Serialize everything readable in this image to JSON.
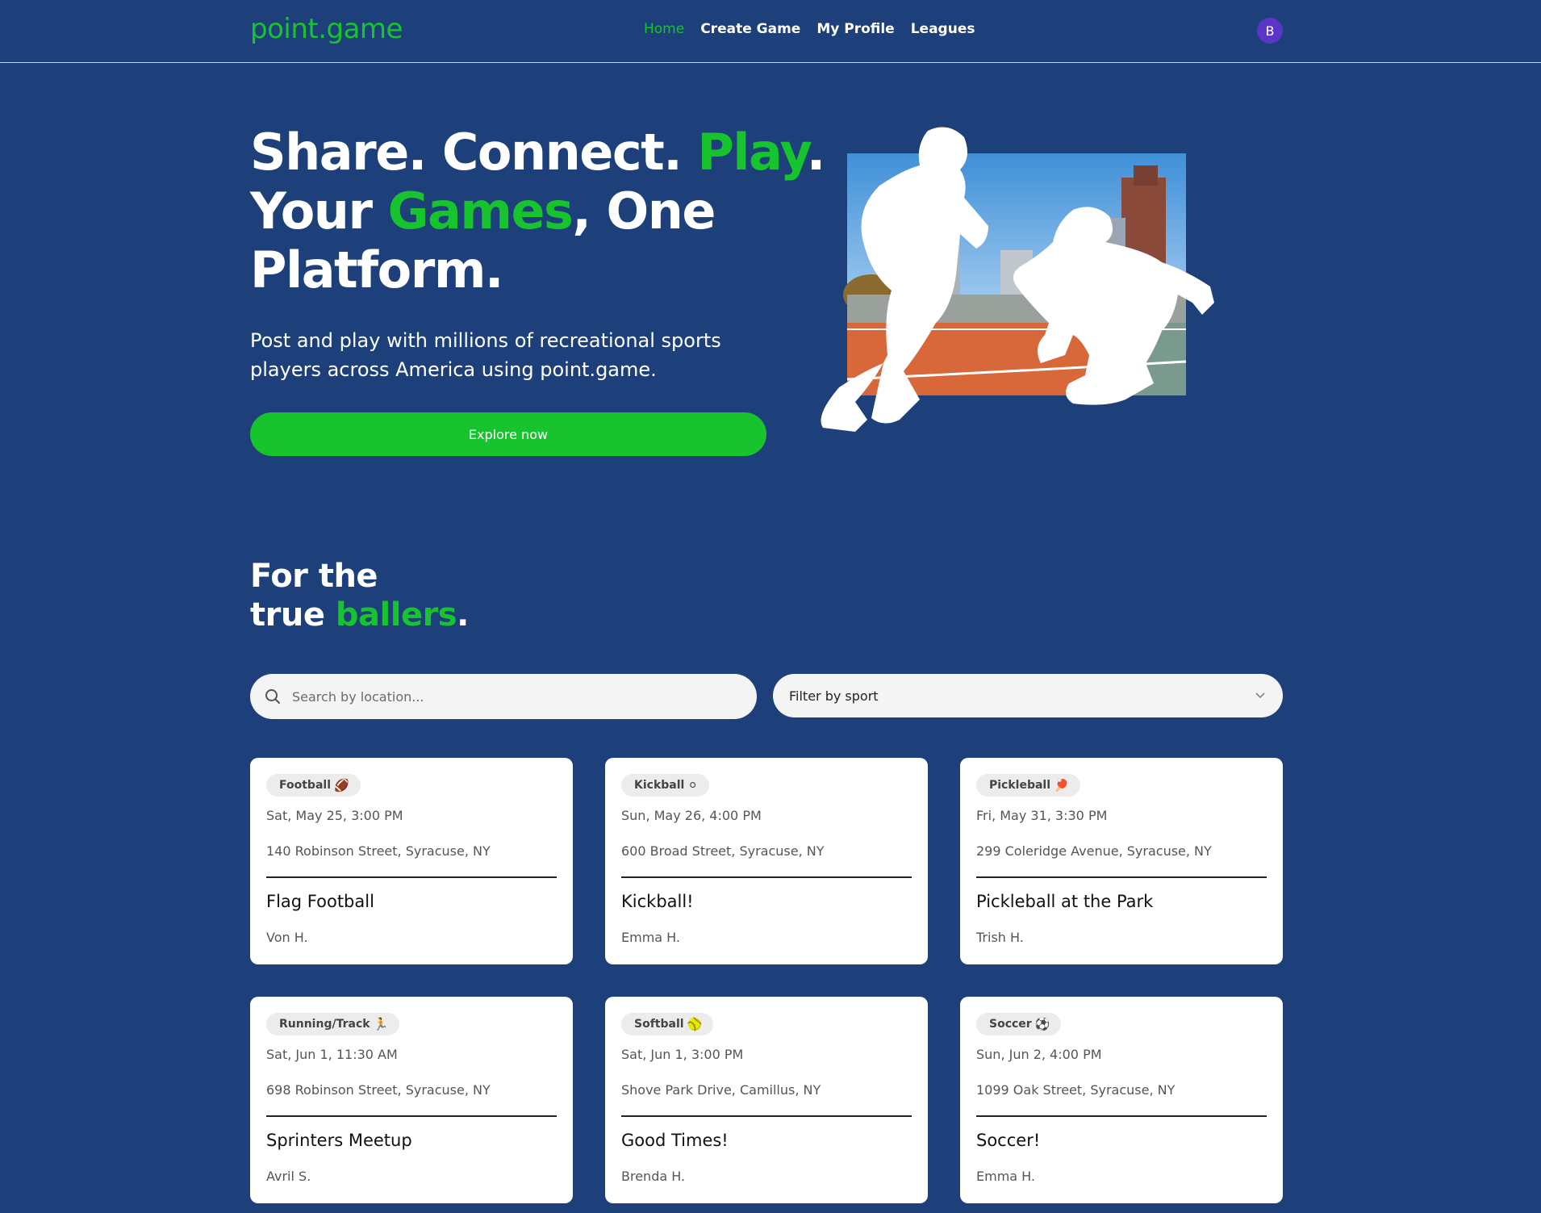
{
  "nav": {
    "brand": "point.game",
    "links": [
      "Home",
      "Create Game",
      "My Profile",
      "Leagues"
    ],
    "avatar_initial": "B"
  },
  "hero": {
    "line1_a": "Share. Connect. ",
    "line1_b": "Play",
    "line1_c": ".",
    "line2_a": "Your ",
    "line2_b": "Games",
    "line2_c": ", One",
    "line3": "Platform.",
    "subtitle": "Post and play with millions of recreational sports players across America using point.game.",
    "cta": "Explore now"
  },
  "section": {
    "line1": "For the",
    "line2_a": "true ",
    "line2_b": "ballers",
    "line2_c": "."
  },
  "search": {
    "placeholder": "Search by location..."
  },
  "filter": {
    "label": "Filter by sport"
  },
  "colors": {
    "accent": "#17c42e",
    "background": "#1d3f7a",
    "avatar": "#5b35c6"
  },
  "games": [
    {
      "sport": "Football",
      "emoji": "🏈",
      "date": "Sat, May 25, 3:00 PM",
      "address": "140 Robinson Street, Syracuse, NY",
      "title": "Flag Football",
      "host": "Von H."
    },
    {
      "sport": "Kickball",
      "emoji": "⚪",
      "date": "Sun, May 26, 4:00 PM",
      "address": "600 Broad Street, Syracuse, NY",
      "title": "Kickball!",
      "host": "Emma H."
    },
    {
      "sport": "Pickleball",
      "emoji": "🏓",
      "date": "Fri, May 31, 3:30 PM",
      "address": "299 Coleridge Avenue, Syracuse, NY",
      "title": "Pickleball at the Park",
      "host": "Trish H."
    },
    {
      "sport": "Running/Track",
      "emoji": "🏃",
      "date": "Sat, Jun 1, 11:30 AM",
      "address": "698 Robinson Street, Syracuse, NY",
      "title": "Sprinters Meetup",
      "host": "Avril S."
    },
    {
      "sport": "Softball",
      "emoji": "🥎",
      "date": "Sat, Jun 1, 3:00 PM",
      "address": "Shove Park Drive, Camillus, NY",
      "title": "Good Times!",
      "host": "Brenda H."
    },
    {
      "sport": "Soccer",
      "emoji": "⚽",
      "date": "Sun, Jun 2, 4:00 PM",
      "address": "1099 Oak Street, Syracuse, NY",
      "title": "Soccer!",
      "host": "Emma H."
    }
  ]
}
